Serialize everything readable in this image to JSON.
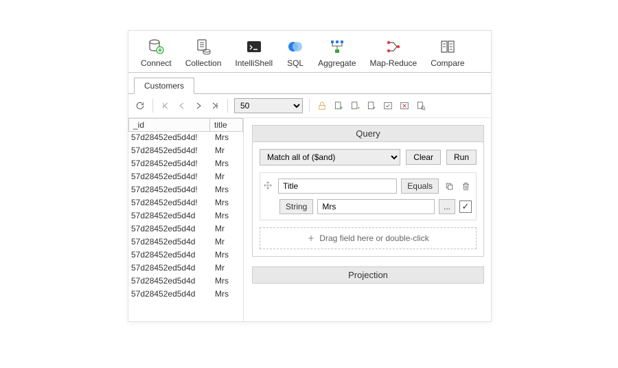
{
  "toolbar": [
    {
      "name": "connect",
      "label": "Connect"
    },
    {
      "name": "collection",
      "label": "Collection"
    },
    {
      "name": "intellishell",
      "label": "IntelliShell"
    },
    {
      "name": "sql",
      "label": "SQL"
    },
    {
      "name": "aggregate",
      "label": "Aggregate"
    },
    {
      "name": "mapreduce",
      "label": "Map-Reduce"
    },
    {
      "name": "compare",
      "label": "Compare"
    }
  ],
  "tab": "Customers",
  "pagesize": "50",
  "grid": {
    "columns": [
      "_id",
      "title"
    ],
    "rows": [
      {
        "id": "57d28452ed5d4d!",
        "title": "Mrs"
      },
      {
        "id": "57d28452ed5d4d!",
        "title": "Mr"
      },
      {
        "id": "57d28452ed5d4d!",
        "title": "Mrs"
      },
      {
        "id": "57d28452ed5d4d!",
        "title": "Mr"
      },
      {
        "id": "57d28452ed5d4d!",
        "title": "Mrs"
      },
      {
        "id": "57d28452ed5d4d!",
        "title": "Mrs"
      },
      {
        "id": "57d28452ed5d4d",
        "title": "Mrs"
      },
      {
        "id": "57d28452ed5d4d",
        "title": "Mr"
      },
      {
        "id": "57d28452ed5d4d",
        "title": "Mr"
      },
      {
        "id": "57d28452ed5d4d",
        "title": "Mrs"
      },
      {
        "id": "57d28452ed5d4d",
        "title": "Mr"
      },
      {
        "id": "57d28452ed5d4d",
        "title": "Mrs"
      },
      {
        "id": "57d28452ed5d4d",
        "title": "Mrs"
      }
    ]
  },
  "query": {
    "title": "Query",
    "match": "Match all of ($and)",
    "clear": "Clear",
    "run": "Run",
    "field": "Title",
    "op": "Equals",
    "type": "String",
    "value": "Mrs",
    "more": "...",
    "drop": "Drag field here or double-click"
  },
  "projection": "Projection"
}
